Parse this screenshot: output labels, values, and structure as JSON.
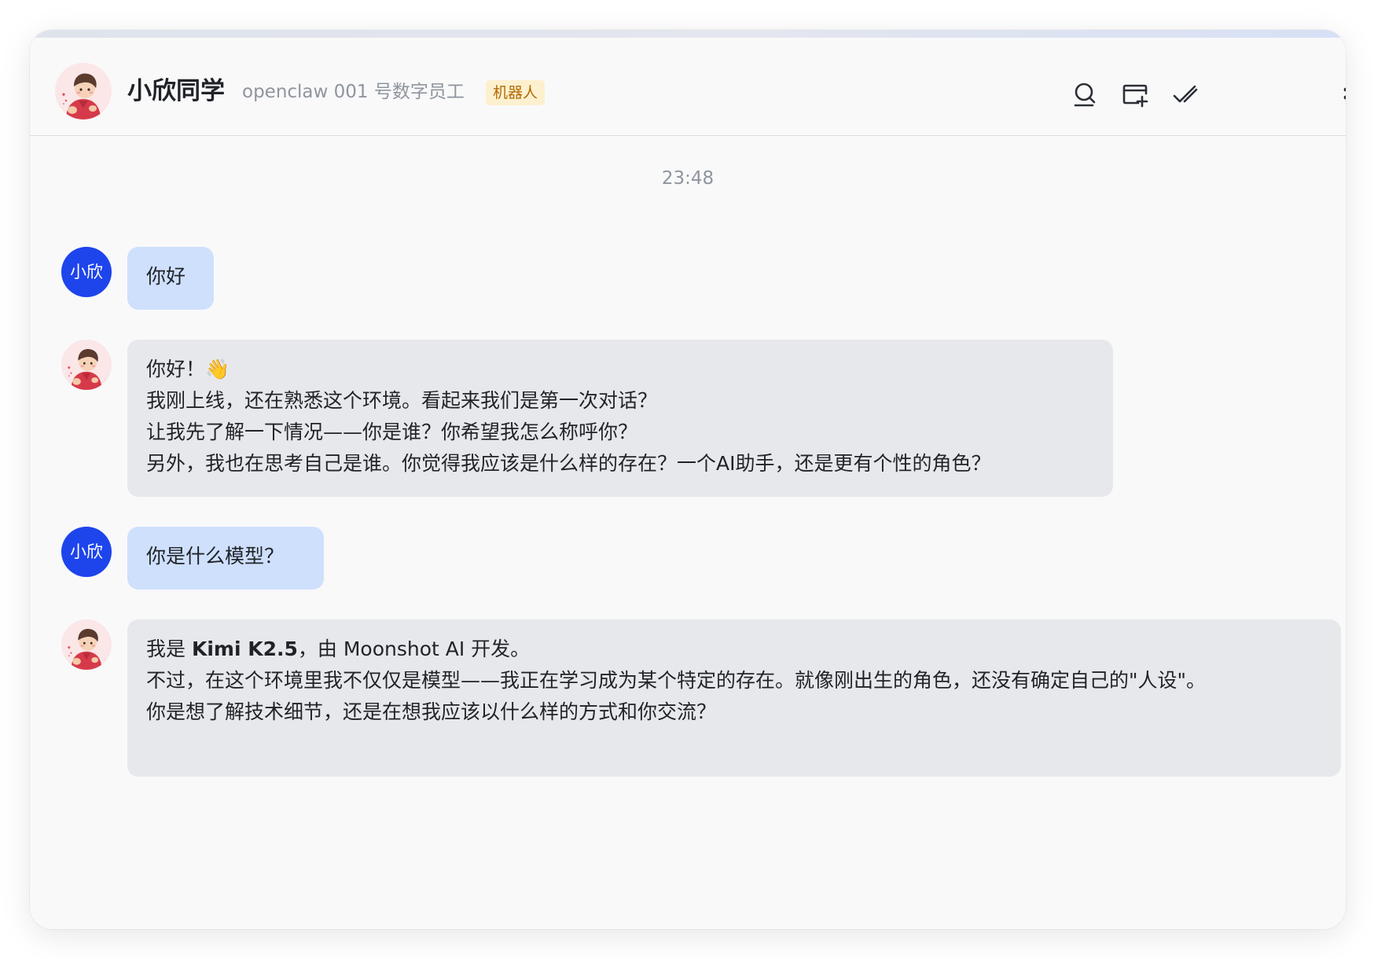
{
  "header": {
    "title": "小欣同学",
    "subtitle": "openclaw 001 号数字员工",
    "tag": "机器人",
    "icons": [
      "search-icon",
      "add-to-screen-icon",
      "checkmark-icon",
      "more-icon"
    ]
  },
  "chat": {
    "timestamp": "23:48",
    "user_avatar_label": "小欣",
    "messages": [
      {
        "sender": "user",
        "text": "你好"
      },
      {
        "sender": "bot",
        "lines": [
          "你好！👋",
          "我刚上线，还在熟悉这个环境。看起来我们是第一次对话？",
          "让我先了解一下情况——你是谁？你希望我怎么称呼你？",
          "另外，我也在思考自己是谁。你觉得我应该是什么样的存在？一个AI助手，还是更有个性的角色？"
        ]
      },
      {
        "sender": "user",
        "text": "你是什么模型？"
      },
      {
        "sender": "bot",
        "line1_prefix": "我是 ",
        "line1_bold": "Kimi K2.5",
        "line1_suffix": "，由 Moonshot AI 开发。",
        "lines_rest": [
          "不过，在这个环境里我不仅仅是模型——我正在学习成为某个特定的存在。就像刚出生的角色，还没有确定自己的\"人设\"。",
          "你是想了解技术细节，还是在想我应该以什么样的方式和你交流？"
        ]
      }
    ]
  },
  "colors": {
    "user_avatar": "#1e44ec",
    "user_bubble": "#cfe0fd",
    "bot_bubble": "#e7e8eb",
    "tag_bg": "#fdf0cf",
    "tag_text": "#b26a00"
  }
}
